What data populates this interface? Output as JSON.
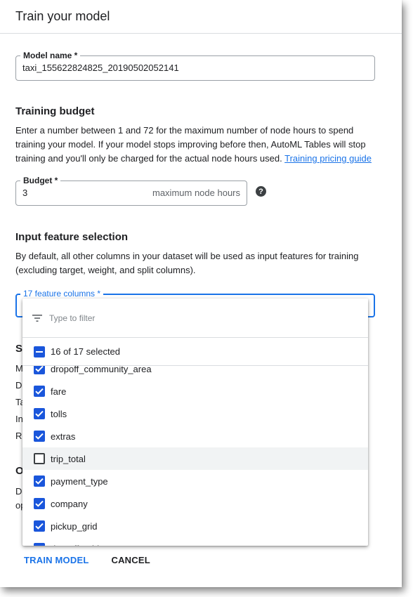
{
  "dialog": {
    "title": "Train your model"
  },
  "model_name": {
    "label": "Model name *",
    "value": "taxi_155622824825_20190502052141"
  },
  "training_budget": {
    "title": "Training budget",
    "description": "Enter a number between 1 and 72 for the maximum number of node hours to spend training your model. If your model stops improving before then, AutoML Tables will stop training and you'll only be charged for the actual node hours used. ",
    "link_text": "Training pricing guide",
    "budget_label": "Budget *",
    "budget_value": "3",
    "budget_suffix": "maximum node hours",
    "help_icon": "help-circle-icon"
  },
  "input_feature_selection": {
    "title": "Input feature selection",
    "description": "By default, all other columns in your dataset will be used as input features for training (excluding target, weight, and split columns).",
    "select_label": "17 feature columns *"
  },
  "behind_dropdown": {
    "s_heading": "S",
    "rows": [
      "M",
      "Da",
      "Ta",
      "In",
      "Re"
    ],
    "o_heading": "O",
    "o_rows": [
      "De",
      "op"
    ]
  },
  "dropdown": {
    "filter_placeholder": "Type to filter",
    "summary": "16 of 17 selected",
    "items": [
      {
        "label": "dropoff_community_area",
        "checked": true
      },
      {
        "label": "fare",
        "checked": true
      },
      {
        "label": "tolls",
        "checked": true
      },
      {
        "label": "extras",
        "checked": true
      },
      {
        "label": "trip_total",
        "checked": false
      },
      {
        "label": "payment_type",
        "checked": true
      },
      {
        "label": "company",
        "checked": true
      },
      {
        "label": "pickup_grid",
        "checked": true
      },
      {
        "label": "dropoff_grid",
        "checked": true
      }
    ]
  },
  "footer": {
    "train_label": "TRAIN MODEL",
    "cancel_label": "CANCEL"
  },
  "colors": {
    "accent": "#1a73e8",
    "checkbox": "#1a56db"
  }
}
